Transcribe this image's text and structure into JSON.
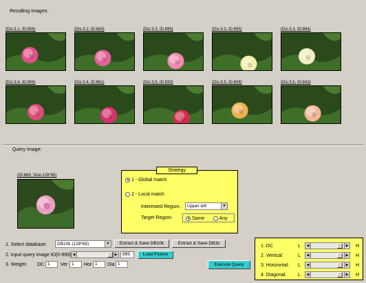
{
  "results": {
    "label": "Resulting Images:",
    "items": [
      {
        "caption": "(Dis:3.1, ID:856)",
        "petal": "#e0508a"
      },
      {
        "caption": "(Dis:3.2, ID:883)",
        "petal": "#e8609a"
      },
      {
        "caption": "(Dis:3.3, ID:895)",
        "petal": "#f08ab4"
      },
      {
        "caption": "(Dis:3.3, ID:855)",
        "petal": "#f4f0b0"
      },
      {
        "caption": "(Dis:3.3, ID:894)",
        "petal": "#f2eec4"
      },
      {
        "caption": "(Dis:3.4, ID:806)",
        "petal": "#e04a7c"
      },
      {
        "caption": "(Dis:3.4, ID:861)",
        "petal": "#d8306e"
      },
      {
        "caption": "(Dis:3.5, ID:833)",
        "petal": "#d82a50"
      },
      {
        "caption": "(Dis:3.5, ID:808)",
        "petal": "#f0b050"
      },
      {
        "caption": "(Dis:3.5, ID:843)",
        "petal": "#f2b898"
      }
    ]
  },
  "query": {
    "label": "Query Image:",
    "caption": "(ID:869, Size:128*85)"
  },
  "strategy": {
    "title": "Strategy",
    "option1": "1 - Global match",
    "option2": "2 - Local match",
    "interested_label": "Interested Region:",
    "interested_value": "Upper left",
    "target_label": "Target Region:",
    "target_same": "Same",
    "target_any": "Any"
  },
  "controls": {
    "db_label": "1. Select database:",
    "db_value": "DB10k (128*85)",
    "extract_10k": "Extract & Save DB10k",
    "extract_1k": "Extract & Save DB1k",
    "query_label": "2. Input query image ID(0-999):",
    "query_value": "869",
    "load_button": "Load Picture",
    "weight_label": "3. Weight:",
    "dc_label": "DC",
    "dc_value": "1",
    "ver_label": "Ver",
    "ver_value": "1",
    "hor_label": "Hor",
    "hor_value": "1",
    "dia_label": "Dia",
    "dia_value": "1",
    "execute_button": "Execute Query"
  },
  "weights": [
    {
      "label": "1. DC",
      "l": "L",
      "h": "H"
    },
    {
      "label": "2. Vertical:",
      "l": "L",
      "h": "H"
    },
    {
      "label": "3. Horizontal:",
      "l": "L",
      "h": "H"
    },
    {
      "label": "4. Diagonal:",
      "l": "L",
      "h": "H"
    }
  ]
}
